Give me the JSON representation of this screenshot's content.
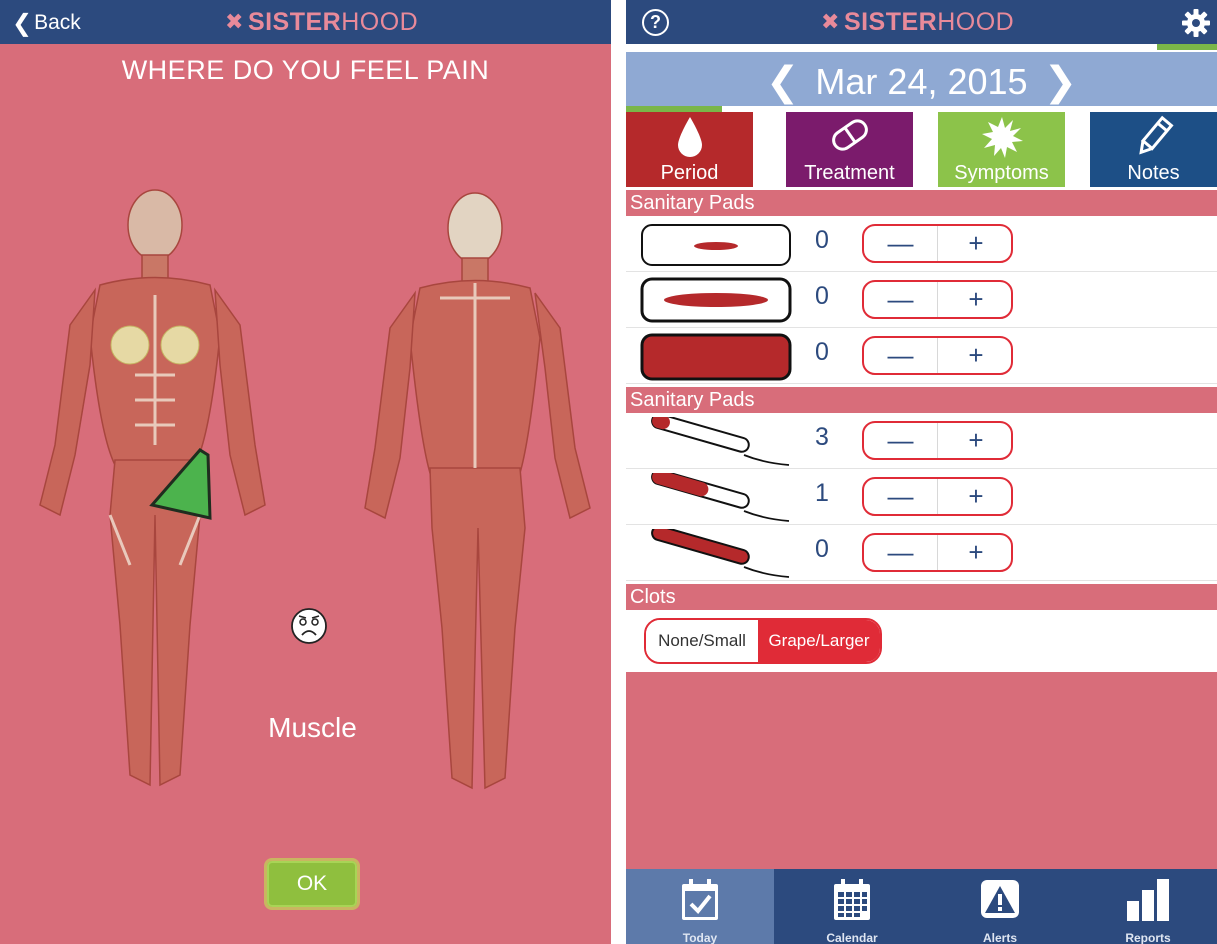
{
  "colors": {
    "appbar": "#2c4a7e",
    "pink": "#d86d7a",
    "red_accent": "#e02b37",
    "green": "#7ab648",
    "period_tab": "#b5292b",
    "treatment_tab": "#7b1b6c",
    "symptoms_tab": "#8cc34a",
    "notes_tab": "#1d4f86"
  },
  "left": {
    "brand_strong": "SISTER",
    "brand_light": "HOOD",
    "back_label": "Back",
    "title": "WHERE DO YOU FEEL PAIN",
    "pain_type": "Muscle",
    "ok_label": "OK",
    "icons": [
      "chevron-left-icon",
      "brand-icon",
      "worried-face-icon"
    ]
  },
  "right": {
    "brand_strong": "SISTER",
    "brand_light": "HOOD",
    "help_icon": "?",
    "date": "Mar 24, 2015",
    "tabs": [
      {
        "label": "Period",
        "icon": "drop-icon"
      },
      {
        "label": "Treatment",
        "icon": "pill-icon"
      },
      {
        "label": "Symptoms",
        "icon": "burst-icon"
      },
      {
        "label": "Notes",
        "icon": "pencil-icon"
      }
    ],
    "sections": [
      {
        "title": "Sanitary Pads",
        "items": [
          {
            "icon": "pad-light-icon",
            "count": "0"
          },
          {
            "icon": "pad-medium-icon",
            "count": "0"
          },
          {
            "icon": "pad-heavy-icon",
            "count": "0"
          }
        ]
      },
      {
        "title": "Sanitary Pads",
        "items": [
          {
            "icon": "tampon-light-icon",
            "count": "3"
          },
          {
            "icon": "tampon-medium-icon",
            "count": "1"
          },
          {
            "icon": "tampon-heavy-icon",
            "count": "0"
          }
        ]
      }
    ],
    "stepper": {
      "minus": "—",
      "plus": "+"
    },
    "clots": {
      "title": "Clots",
      "option_small": "None/Small",
      "option_large": "Grape/Larger",
      "selected": "Grape/Larger"
    },
    "nav": [
      {
        "label": "Today",
        "icon": "calendar-check-icon",
        "active": true
      },
      {
        "label": "Calendar",
        "icon": "calendar-icon",
        "active": false
      },
      {
        "label": "Alerts",
        "icon": "alert-icon",
        "active": false
      },
      {
        "label": "Reports",
        "icon": "bar-chart-icon",
        "active": false
      }
    ]
  }
}
